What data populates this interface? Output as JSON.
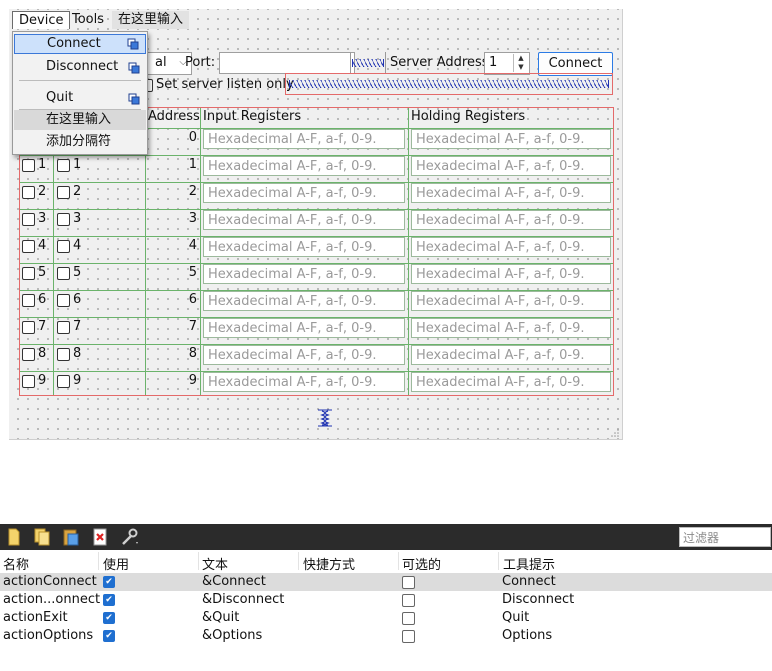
{
  "menubar": {
    "items": [
      "Device",
      "Tools"
    ],
    "type_here": "在这里输入"
  },
  "device_menu": {
    "items": [
      "Connect",
      "Disconnect",
      "Quit"
    ],
    "type_here": "在这里输入",
    "add_separator": "添加分隔符"
  },
  "connection": {
    "combo_value": "al",
    "port_label": "Port:",
    "port_value": "",
    "server_address_label": "Server Address:",
    "server_address_value": "1",
    "connect_button": "Connect",
    "listen_only_label": "Set server listen only"
  },
  "registers": {
    "headers": {
      "address": "Address",
      "input": "Input Registers",
      "holding": "Holding Registers"
    },
    "placeholder": "Hexadecimal A-F, a-f, 0-9.",
    "rows": [
      "0",
      "1",
      "2",
      "3",
      "4",
      "5",
      "6",
      "7",
      "8",
      "9"
    ],
    "coil_labels": [
      "1",
      "2",
      "3",
      "4",
      "5",
      "6",
      "7",
      "8",
      "9"
    ],
    "discrete_labels": [
      "1",
      "2",
      "3",
      "4",
      "5",
      "6",
      "7",
      "8",
      "9"
    ]
  },
  "action_editor": {
    "filter_placeholder": "过滤器",
    "columns": [
      "名称",
      "使用",
      "文本",
      "快捷方式",
      "可选的",
      "工具提示"
    ],
    "actions": [
      {
        "name": "actionConnect",
        "used": true,
        "text": "&Connect",
        "shortcut": "",
        "checkable": false,
        "tooltip": "Connect"
      },
      {
        "name": "action...onnect",
        "used": true,
        "text": "&Disconnect",
        "shortcut": "",
        "checkable": false,
        "tooltip": "Disconnect"
      },
      {
        "name": "actionExit",
        "used": true,
        "text": "&Quit",
        "shortcut": "",
        "checkable": false,
        "tooltip": "Quit"
      },
      {
        "name": "actionOptions",
        "used": true,
        "text": "&Options",
        "shortcut": "",
        "checkable": false,
        "tooltip": "Options"
      }
    ],
    "toolbar_icons": [
      "new-action-icon",
      "copy-action-icon",
      "paste-action-icon",
      "delete-action-icon",
      "configure-icon"
    ]
  },
  "colors": {
    "accent": "#2c7be5",
    "red_frame": "#e46a6a",
    "green_grid": "#6bb36b",
    "toolbar_bg": "#2b2b2b",
    "highlight_row": "#dcdcdc"
  }
}
